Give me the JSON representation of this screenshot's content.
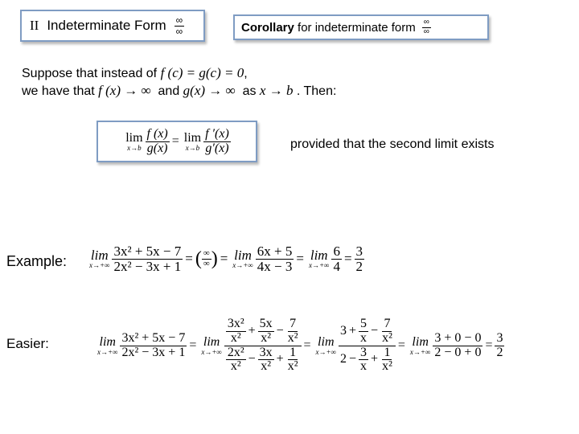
{
  "header_left": {
    "numeral": "II",
    "title": "Indeterminate Form",
    "frac_num": "∞",
    "frac_den": "∞"
  },
  "header_right": {
    "bold": "Corollary",
    "rest": " for indeterminate form",
    "frac_num": "∞",
    "frac_den": "∞"
  },
  "intro": {
    "line1_text": "Suppose that instead of ",
    "line1_math": "f (c) = g(c) = 0",
    "line1_end": ",",
    "line2_a": "we have that ",
    "line2_m1": "f (x) → ∞",
    "line2_b": "  and ",
    "line2_m2": "g(x) → ∞",
    "line2_c": "  as ",
    "line2_m3": "x → b",
    "line2_d": " . Then:"
  },
  "theorem": {
    "lim": "lim",
    "sub": "x→b",
    "lhs_num": "f (x)",
    "lhs_den": "g(x)",
    "eq": "=",
    "rhs_num": "f ′(x)",
    "rhs_den": "g′(x)"
  },
  "condition": "provided that the second limit exists",
  "example": {
    "label": "Example:",
    "lim": "lim",
    "sub": "x→+∞",
    "f1_num": "3x² + 5x − 7",
    "f1_den": "2x² − 3x + 1",
    "form_num": "∞",
    "form_den": "∞",
    "f2_num": "6x + 5",
    "f2_den": "4x − 3",
    "f3_num": "6",
    "f3_den": "4",
    "res_num": "3",
    "res_den": "2",
    "eq": "="
  },
  "easier": {
    "label": "Easier:",
    "lim": "lim",
    "sub": "x→+∞",
    "f1_num": "3x² + 5x − 7",
    "f1_den": "2x² − 3x + 1",
    "s2_top": [
      [
        "3x²",
        "x²"
      ],
      [
        "5x",
        "x²"
      ],
      [
        "7",
        "x²"
      ]
    ],
    "s2_top_ops": [
      "+",
      "−"
    ],
    "s2_bot": [
      [
        "2x²",
        "x²"
      ],
      [
        "3x",
        "x²"
      ],
      [
        "1",
        "x²"
      ]
    ],
    "s2_bot_ops": [
      "−",
      "+"
    ],
    "s3_top_lead": "3",
    "s3_top": [
      [
        "5",
        "x"
      ],
      [
        "7",
        "x²"
      ]
    ],
    "s3_top_ops": [
      "+",
      "−"
    ],
    "s3_bot_lead": "2",
    "s3_bot": [
      [
        "3",
        "x"
      ],
      [
        "1",
        "x²"
      ]
    ],
    "s3_bot_ops": [
      "−",
      "+"
    ],
    "s4_num": "3 + 0 − 0",
    "s4_den": "2 − 0 + 0",
    "res_num": "3",
    "res_den": "2",
    "eq": "="
  }
}
